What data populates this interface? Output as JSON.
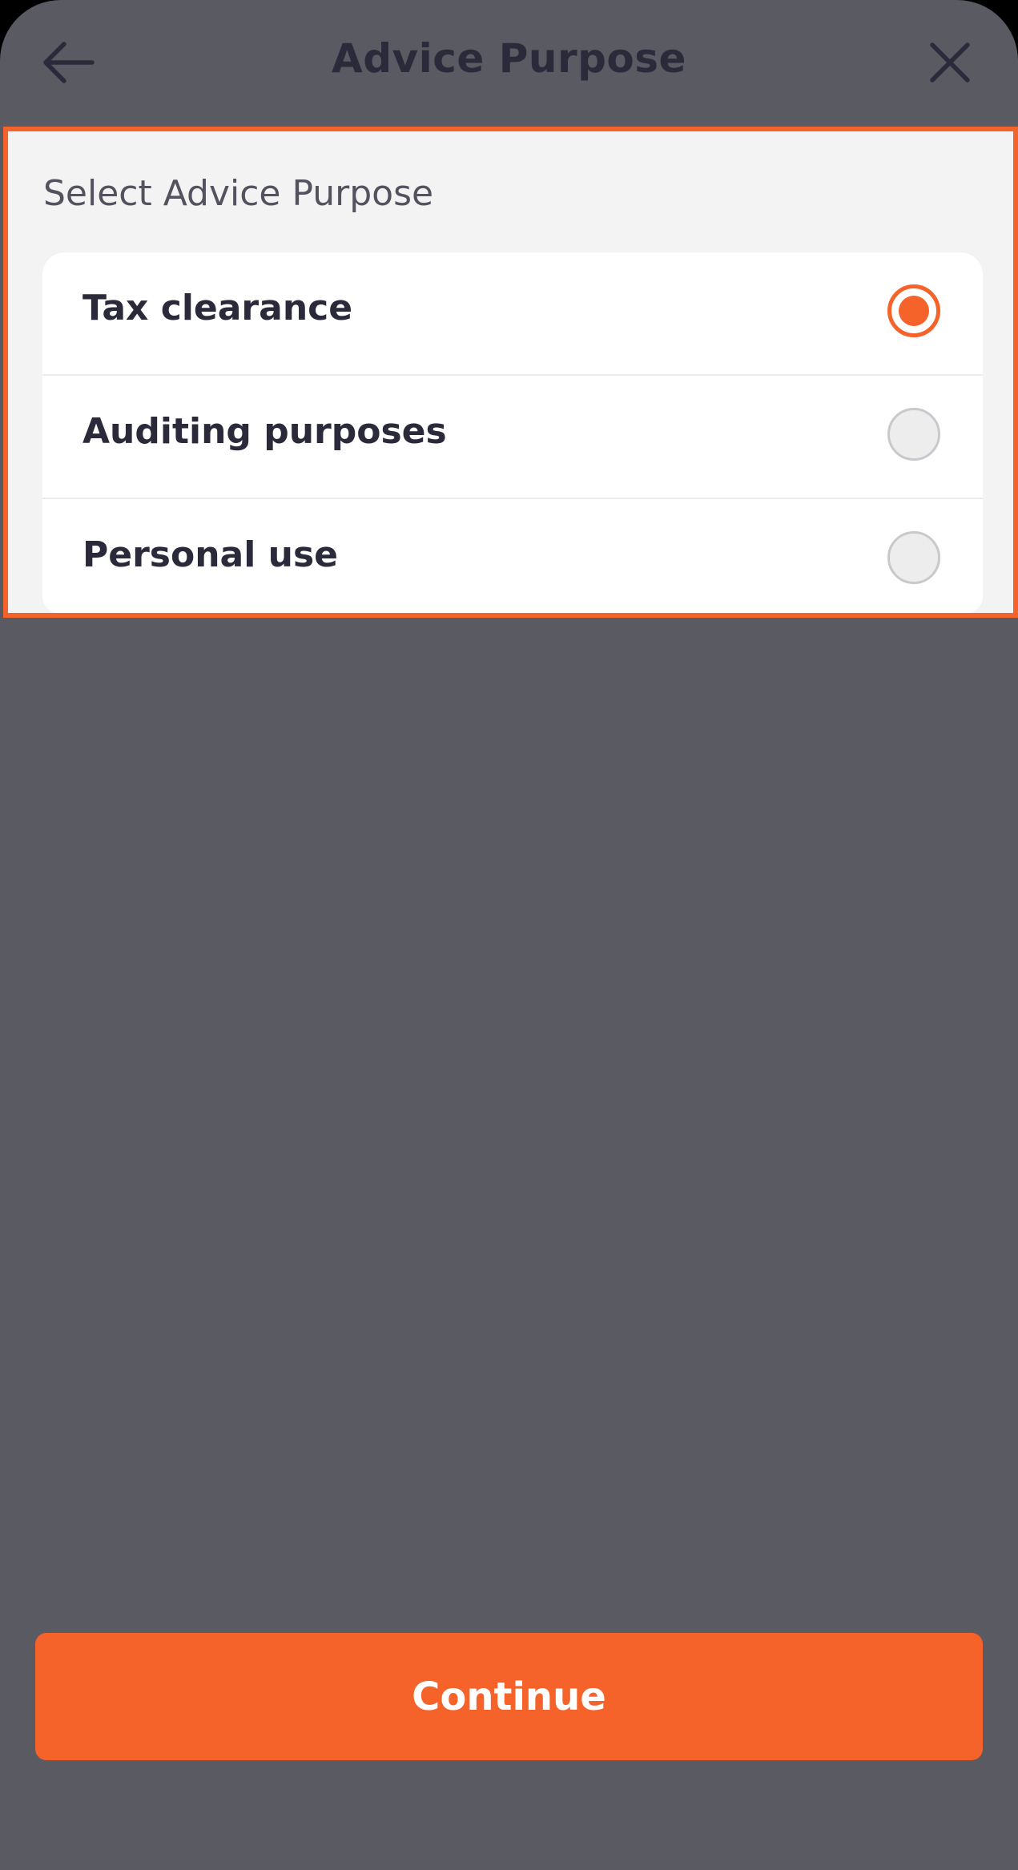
{
  "header": {
    "title": "Advice Purpose",
    "back_icon": "arrow-left-icon",
    "close_icon": "close-icon"
  },
  "section": {
    "label": "Select Advice Purpose"
  },
  "options": [
    {
      "label": "Tax clearance",
      "selected": true
    },
    {
      "label": "Auditing purposes",
      "selected": false
    },
    {
      "label": "Personal use",
      "selected": false
    }
  ],
  "footer": {
    "continue_label": "Continue"
  },
  "colors": {
    "accent": "#f5632a",
    "overlay": "#5a5a63",
    "text_dark": "#2b2a3a",
    "panel": "#f3f3f3"
  }
}
